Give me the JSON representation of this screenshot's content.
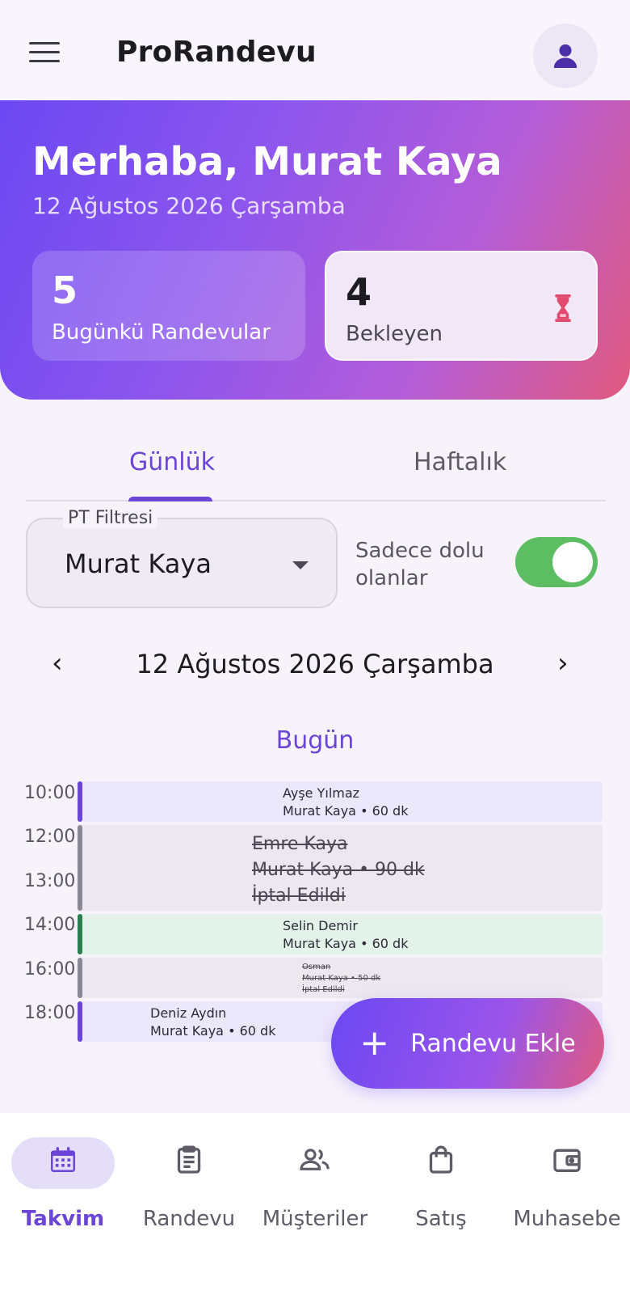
{
  "app": {
    "title": "ProRandevu"
  },
  "hero": {
    "greeting": "Merhaba, Murat Kaya",
    "date": "12 Ağustos 2026 Çarşamba",
    "stats": [
      {
        "value": "5",
        "label": "Bugünkü Randevular"
      },
      {
        "value": "4",
        "label": "Bekleyen"
      }
    ]
  },
  "tabs": {
    "daily": "Günlük",
    "weekly": "Haftalık"
  },
  "filter": {
    "pt_label": "PT Filtresi",
    "pt_value": "Murat Kaya",
    "only_full_label": "Sadece dolu olanlar",
    "only_full_on": true
  },
  "date_nav": {
    "title": "12 Ağustos 2026 Çarşamba",
    "prev": "‹",
    "next": "›"
  },
  "today_label": "Bugün",
  "hours": [
    "10:00",
    "12:00",
    "13:00",
    "14:00",
    "16:00",
    "18:00"
  ],
  "events": [
    {
      "name": "Ayşe Yılmaz",
      "detail": "Murat Kaya • 60 dk"
    },
    {
      "name": "Emre Kaya",
      "detail": "Murat Kaya • 90 dk",
      "status": "İptal Edildi"
    },
    {
      "name": "Selin Demir",
      "detail": "Murat Kaya • 60 dk"
    },
    {
      "name": "Osman",
      "detail": "Murat Kaya • 50 dk",
      "status": "İptal Edildi"
    },
    {
      "name": "Deniz Aydın",
      "detail": "Murat Kaya • 60 dk"
    }
  ],
  "fab": {
    "plus": "+",
    "label": "Randevu Ekle"
  },
  "bottom_nav": [
    {
      "label": "Takvim",
      "icon": "calendar-icon",
      "active": true
    },
    {
      "label": "Randevu",
      "icon": "clipboard-icon"
    },
    {
      "label": "Müşteriler",
      "icon": "users-icon"
    },
    {
      "label": "Satış",
      "icon": "shopping-bag-icon"
    },
    {
      "label": "Muhasebe",
      "icon": "wallet-icon"
    }
  ],
  "colors": {
    "primary": "#6a45d6",
    "gradient_start": "#6b48f2",
    "gradient_end": "#e05a7e",
    "toggle_on": "#5dbd63",
    "cancel_gray": "#8a8894",
    "event_green": "#2e7d4f"
  }
}
